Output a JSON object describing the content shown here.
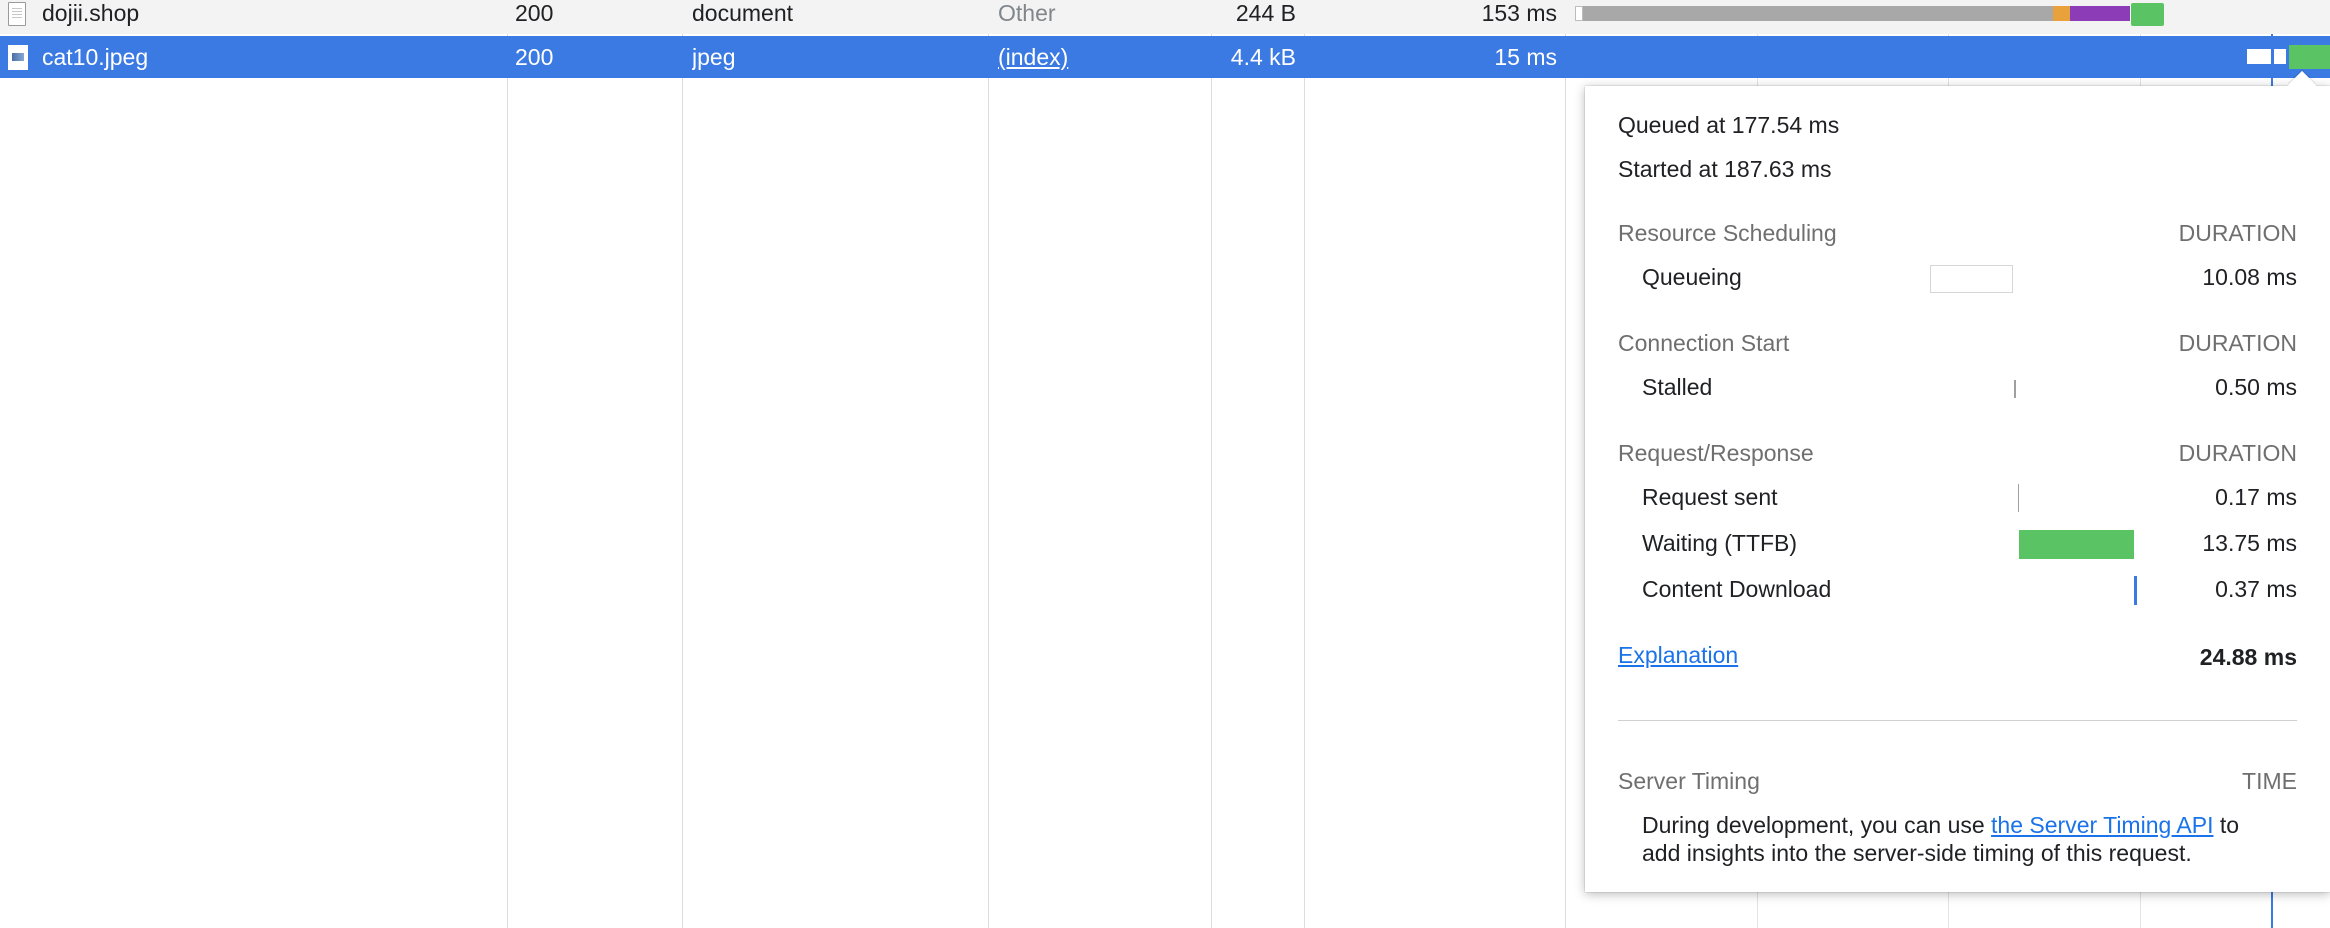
{
  "columns_note": "",
  "rows": [
    {
      "name": "dojii.shop",
      "status": "200",
      "type": "document",
      "initiator": "Other",
      "size": "244 B",
      "time": "153 ms",
      "icon": "document-file-icon"
    },
    {
      "name": "cat10.jpeg",
      "status": "200",
      "type": "jpeg",
      "initiator": "(index)",
      "size": "4.4 kB",
      "time": "15 ms",
      "icon": "image-file-icon",
      "selected": true
    }
  ],
  "colors": {
    "selection": "#3b7ae3",
    "waiting_bar": "#5ac464",
    "download_bar": "#3b7ae3",
    "queueing_box_border": "#d6d6d6",
    "stalled_bar": "#a0a0a0",
    "ssl_bar": "#e8a13b",
    "purple_bar": "#8c3cb7"
  },
  "timing": {
    "queued_at": "Queued at 177.54 ms",
    "started_at": "Started at 187.63 ms",
    "sections": [
      {
        "title": "Resource Scheduling",
        "duration_label": "DURATION",
        "items": [
          {
            "label": "Queueing",
            "value": "10.08 ms"
          }
        ]
      },
      {
        "title": "Connection Start",
        "duration_label": "DURATION",
        "items": [
          {
            "label": "Stalled",
            "value": "0.50 ms"
          }
        ]
      },
      {
        "title": "Request/Response",
        "duration_label": "DURATION",
        "items": [
          {
            "label": "Request sent",
            "value": "0.17 ms"
          },
          {
            "label": "Waiting (TTFB)",
            "value": "13.75 ms"
          },
          {
            "label": "Content Download",
            "value": "0.37 ms"
          }
        ]
      }
    ],
    "explanation_link": "Explanation",
    "total": "24.88 ms",
    "server_timing": {
      "title": "Server Timing",
      "time_label": "TIME",
      "text_before": "During development, you can use ",
      "link": "the Server Timing API",
      "text_after": " to",
      "text_line2": "add insights into the server-side timing of this request."
    }
  }
}
